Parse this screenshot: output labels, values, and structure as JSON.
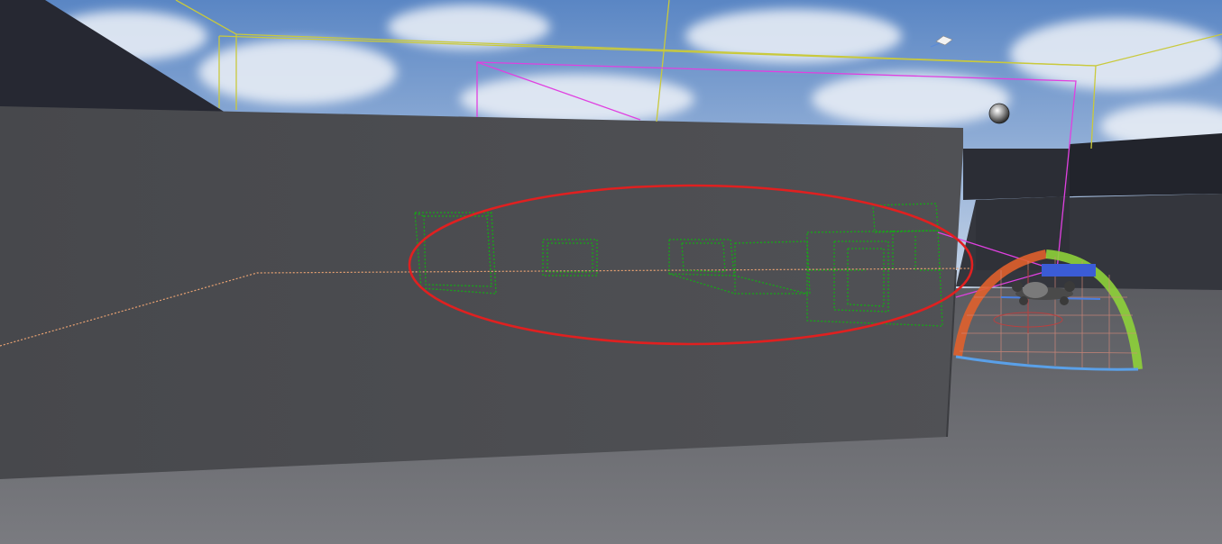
{
  "scene": {
    "colors": {
      "sky_top": "#5a86c4",
      "sky_bottom": "#c9d7e9",
      "cloud": "#e9eef5",
      "wall_front": "#4b4c50",
      "wall_top_edge": "#3e3f43",
      "wall_dark_side": "#2a2c33",
      "ceiling_dark": "#262832",
      "floor": "#6a6b70",
      "floor_far": "#5b5c61",
      "trigger_box_green": "#14a314",
      "navigation_line_orange": "#e9a272",
      "volume_box_yellow": "#c8c83a",
      "volume_box_magenta": "#e040e0",
      "highlight_ellipse_red": "#e02020",
      "rotation_gizmo_orange": "#e0602c",
      "rotation_gizmo_green": "#8ed13a",
      "gizmo_blue": "#3b6de3"
    },
    "icons": [
      "reflection-sphere-icon",
      "directional-light-icon",
      "drone-actor-icon",
      "rotation-gizmo-icon"
    ]
  }
}
